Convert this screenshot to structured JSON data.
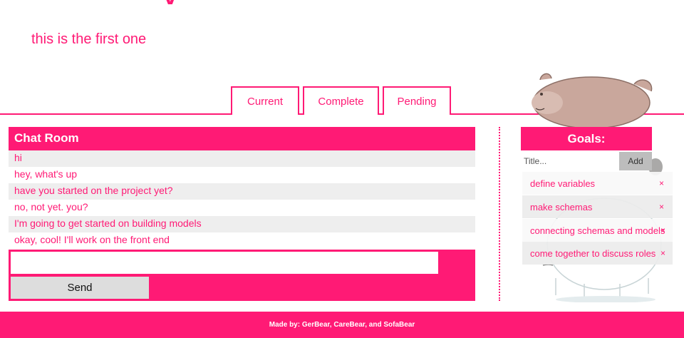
{
  "page": {
    "subtitle": "this is the first one"
  },
  "tabs": [
    {
      "label": "Current"
    },
    {
      "label": "Complete"
    },
    {
      "label": "Pending"
    }
  ],
  "chat": {
    "title": "Chat Room",
    "messages": [
      {
        "text": "hi"
      },
      {
        "text": "hey, what's up"
      },
      {
        "text": "have you started on the project yet?"
      },
      {
        "text": "no, not yet. you?"
      },
      {
        "text": "I'm going to get started on building models"
      },
      {
        "text": "okay, cool! I'll work on the front end"
      }
    ],
    "input_value": "",
    "send_label": "Send"
  },
  "goals": {
    "title": "Goals:",
    "input_placeholder": "Title...",
    "add_label": "Add",
    "remove_symbol": "×",
    "items": [
      {
        "label": "define variables"
      },
      {
        "label": "make schemas"
      },
      {
        "label": "connecting schemas and models"
      },
      {
        "label": "come together to discuss roles"
      }
    ]
  },
  "footer": {
    "text": "Made by: GerBear, CareBear, and SofaBear"
  },
  "colors": {
    "accent": "#ff1a75",
    "message_stripe": "#eeeeee",
    "send_button": "#dddddd",
    "add_button": "#bdbdbd"
  },
  "icons": {
    "illustration_top": "bear-illustration",
    "illustration_bottom": "bear-illustration"
  }
}
